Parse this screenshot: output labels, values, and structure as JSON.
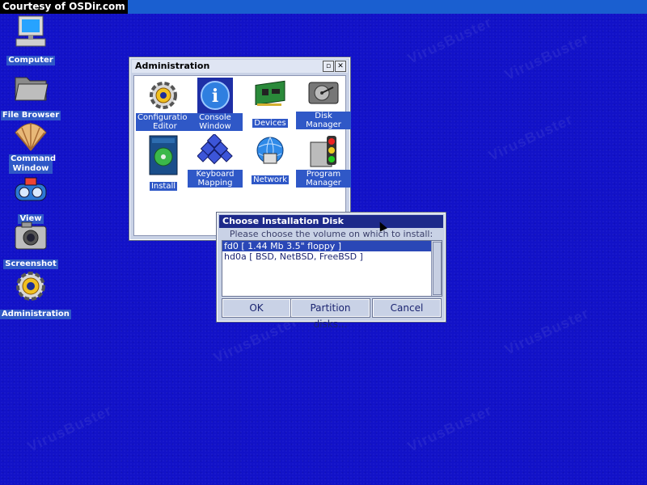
{
  "courtesy": "Courtesy of OSDir.com",
  "watermark_text": "VirusBuster",
  "desktop": {
    "icons": [
      {
        "label": "Computer",
        "icon": "computer-icon"
      },
      {
        "label": "File Browser",
        "icon": "folder-icon"
      },
      {
        "label": "Command Window",
        "icon": "shell-icon"
      },
      {
        "label": "View",
        "icon": "viewmaster-icon"
      },
      {
        "label": "Screenshot",
        "icon": "camera-icon"
      },
      {
        "label": "Administration",
        "icon": "gear-icon"
      }
    ]
  },
  "admin_window": {
    "title": "Administration",
    "icons": [
      {
        "label": "Configuration Editor",
        "icon": "gear-icon"
      },
      {
        "label": "Console Window",
        "icon": "info-icon"
      },
      {
        "label": "Devices",
        "icon": "circuit-board-icon"
      },
      {
        "label": "Disk Manager",
        "icon": "hard-disk-icon"
      },
      {
        "label": "Install",
        "icon": "install-box-icon"
      },
      {
        "label": "Keyboard Mapping",
        "icon": "keyboard-icon"
      },
      {
        "label": "Network",
        "icon": "network-icon"
      },
      {
        "label": "Program Manager",
        "icon": "traffic-light-icon"
      }
    ]
  },
  "install_dialog": {
    "title": "Choose Installation Disk",
    "prompt": "Please choose the volume on which to install:",
    "volumes": [
      {
        "text": "fd0  [ 1.44 Mb 3.5\" floppy ]",
        "selected": true
      },
      {
        "text": "hd0a  [ BSD, NetBSD, FreeBSD ]",
        "selected": false
      }
    ],
    "buttons": {
      "ok": "OK",
      "partition": "Partition disks...",
      "cancel": "Cancel"
    }
  },
  "colors": {
    "desktop": "#1212c8",
    "label_bg": "#2f58c7",
    "selection": "#2a47b6"
  }
}
